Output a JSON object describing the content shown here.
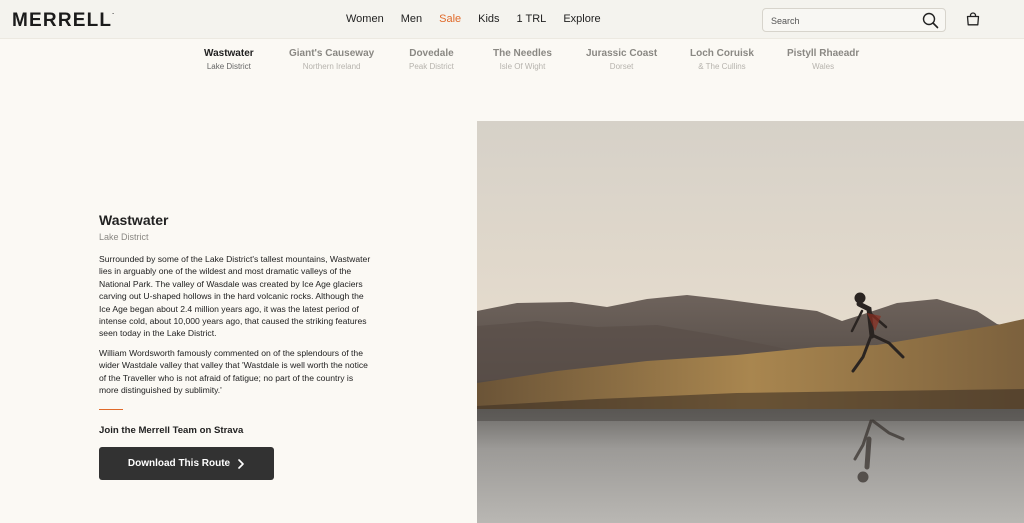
{
  "header": {
    "logo": "MERRELL",
    "logo_mark": ".",
    "nav": [
      "Women",
      "Men",
      "Sale",
      "Kids",
      "1 TRL",
      "Explore"
    ],
    "search_placeholder": "Search",
    "sale_color": "#e06a2a"
  },
  "locations": [
    {
      "name": "Wastwater",
      "region": "Lake District",
      "active": true
    },
    {
      "name": "Giant's Causeway",
      "region": "Northern Ireland",
      "active": false
    },
    {
      "name": "Dovedale",
      "region": "Peak District",
      "active": false
    },
    {
      "name": "The Needles",
      "region": "Isle Of Wight",
      "active": false
    },
    {
      "name": "Jurassic Coast",
      "region": "Dorset",
      "active": false
    },
    {
      "name": "Loch Coruisk",
      "region": "& The Cullins",
      "active": false
    },
    {
      "name": "Pistyll Rhaeadr",
      "region": "Wales",
      "active": false
    }
  ],
  "content": {
    "title": "Wastwater",
    "subtitle": "Lake District",
    "para1": "Surrounded by some of the Lake District's tallest mountains, Wastwater lies in arguably one of the wildest and most dramatic valleys of the National Park. The valley of Wasdale was created by Ice Age glaciers carving out U-shaped hollows in the hard volcanic rocks. Although the Ice Age began about 2.4 million years ago, it was the latest period of intense cold, about 10,000 years ago, that caused the striking features seen today in the Lake District.",
    "para2": "William Wordsworth famously commented on of the splendours of the wider Wastdale valley that valley that 'Wastdale is well worth the notice of the Traveller who is not afraid of fatigue; no part of the country is more distinguished by sublimity.'",
    "strava_heading": "Join the Merrell Team on Strava",
    "download_label": "Download This Route",
    "accent_color": "#e06a2a"
  },
  "icons": {
    "search": "search-icon",
    "cart": "shopping-bag-icon",
    "chevron": "chevron-right-icon"
  }
}
